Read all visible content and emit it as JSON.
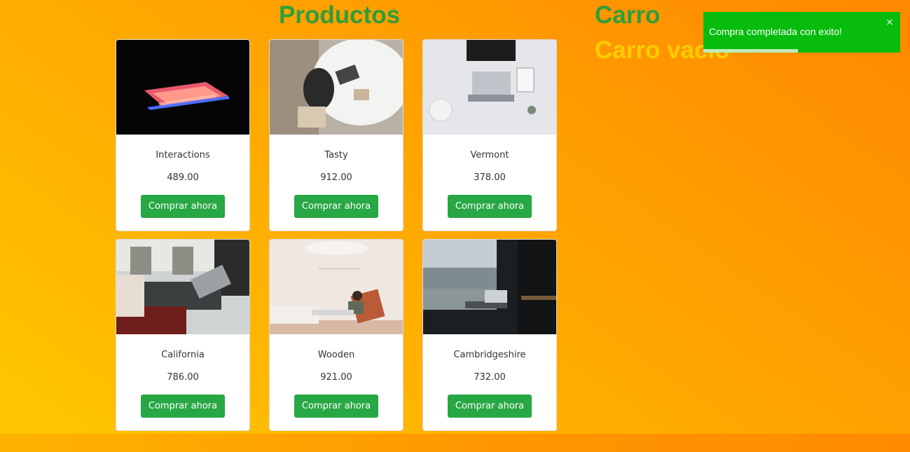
{
  "products_title": "Productos",
  "cart": {
    "title": "Carro",
    "empty_text": "Carro vacío"
  },
  "toast": {
    "message": "Compra completada con exito!",
    "close_glyph": "×",
    "progress_remaining": 0.48
  },
  "buy_label": "Comprar ahora",
  "products": [
    {
      "name": "Interactions",
      "price": "489.00",
      "image": "dark-laptop-photo"
    },
    {
      "name": "Tasty",
      "price": "912.00",
      "image": "woman-at-desk-photo"
    },
    {
      "name": "Vermont",
      "price": "378.00",
      "image": "laptop-typing-photo"
    },
    {
      "name": "California",
      "price": "786.00",
      "image": "cafe-laptop-photo"
    },
    {
      "name": "Wooden",
      "price": "921.00",
      "image": "man-chair-laptop-photo"
    },
    {
      "name": "Cambridgeshire",
      "price": "732.00",
      "image": "office-window-photo"
    }
  ],
  "colors": {
    "accent": "#28a745",
    "title_green": "#2e9e3a",
    "empty_yellow": "#ffcc00",
    "toast_green": "#07bc0c"
  }
}
